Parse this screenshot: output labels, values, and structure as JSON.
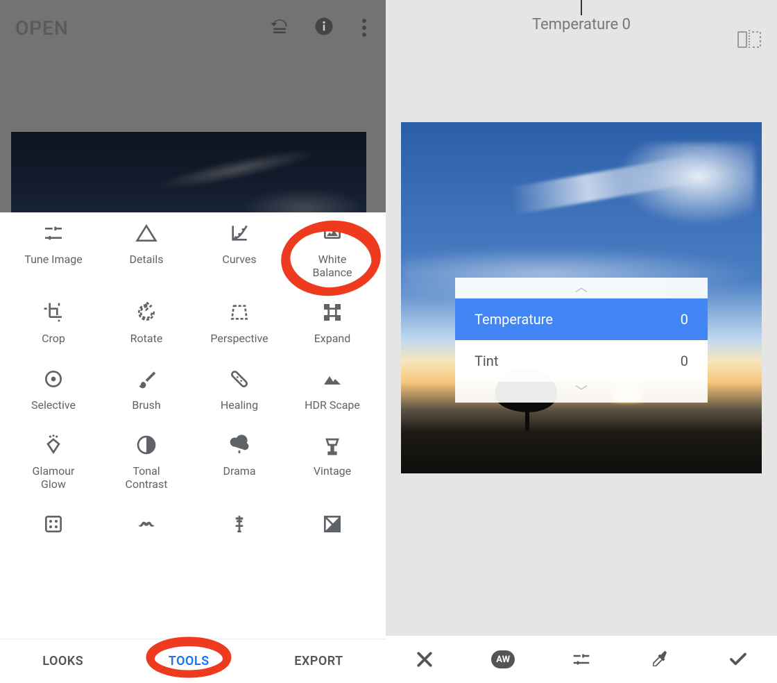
{
  "left": {
    "open": "OPEN",
    "tools": [
      {
        "label": "Tune Image"
      },
      {
        "label": "Details"
      },
      {
        "label": "Curves"
      },
      {
        "label": "White\nBalance"
      },
      {
        "label": "Crop"
      },
      {
        "label": "Rotate"
      },
      {
        "label": "Perspective"
      },
      {
        "label": "Expand"
      },
      {
        "label": "Selective"
      },
      {
        "label": "Brush"
      },
      {
        "label": "Healing"
      },
      {
        "label": "HDR Scape"
      },
      {
        "label": "Glamour\nGlow"
      },
      {
        "label": "Tonal\nContrast"
      },
      {
        "label": "Drama"
      },
      {
        "label": "Vintage"
      }
    ],
    "tabs": {
      "looks": "LOOKS",
      "tools": "TOOLS",
      "export": "EXPORT"
    }
  },
  "right": {
    "title": "Temperature 0",
    "params": {
      "temperature_label": "Temperature",
      "temperature_value": "0",
      "tint_label": "Tint",
      "tint_value": "0"
    },
    "aw": "AW"
  },
  "annotations": {
    "wb_circle": true,
    "tools_circle": true
  }
}
